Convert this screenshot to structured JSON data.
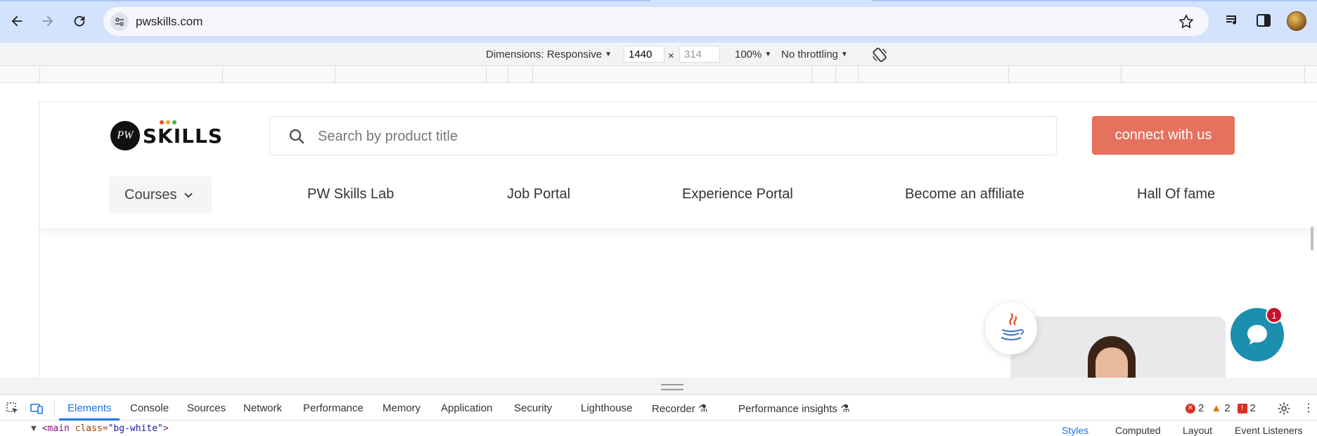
{
  "browser": {
    "url": "pwskills.com",
    "buttons": {
      "back": "back-icon",
      "forward": "forward-icon",
      "reload": "reload-icon"
    }
  },
  "device_toolbar": {
    "dimensions_label": "Dimensions: Responsive",
    "width": "1440",
    "height": "314",
    "times": "×",
    "zoom": "100%",
    "throttling": "No throttling"
  },
  "site": {
    "logo_text": "SKILLS",
    "logo_mark": "PW",
    "search_placeholder": "Search by product title",
    "cta_label": "connect with us",
    "courses_label": "Courses",
    "nav": [
      "PW Skills Lab",
      "Job Portal",
      "Experience Portal",
      "Become an affiliate",
      "Hall Of fame"
    ],
    "chat_badge": "1",
    "colors": {
      "cta": "#e5715f",
      "chat": "#1c8fae",
      "badge": "#c8102e"
    }
  },
  "devtools": {
    "tabs": [
      "Elements",
      "Console",
      "Sources",
      "Network",
      "Performance",
      "Memory",
      "Application",
      "Security",
      "Lighthouse",
      "Recorder",
      "Performance insights"
    ],
    "errors": "2",
    "warnings": "2",
    "issues": "2",
    "dom_tag": "<main",
    "dom_attr": "class=",
    "dom_value": "\"bg-white\"",
    "dom_close": ">",
    "side_tabs": [
      "Styles",
      "Computed",
      "Layout",
      "Event Listeners"
    ]
  }
}
